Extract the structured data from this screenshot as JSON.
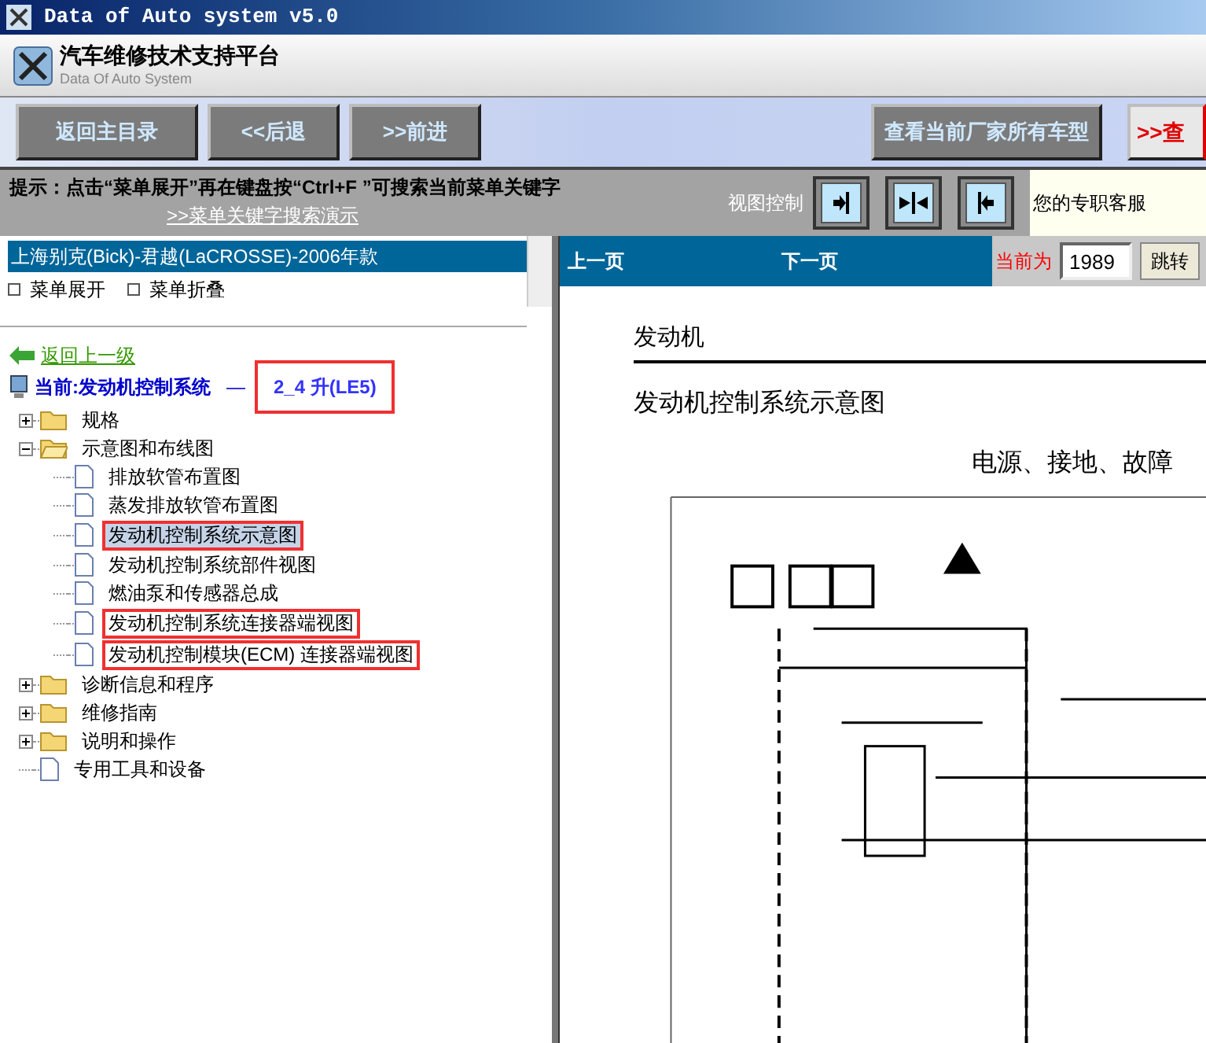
{
  "window": {
    "title": "Data of Auto system v5.0"
  },
  "header": {
    "title": "汽车维修技术支持平台",
    "subtitle": "Data Of Auto System"
  },
  "toolbar": {
    "left_buttons": [
      "返回主目录",
      "<<后退",
      ">>前进"
    ],
    "right_button": "查看当前厂家所有车型",
    "cut_button": ">>查"
  },
  "hint": {
    "text": "提示：点击“菜单展开”再在键盘按“Ctrl+F ”可搜索当前菜单关键字",
    "link": ">>菜单关键字搜索演示",
    "view_label": "视图控制",
    "view_buttons": [
      {
        "kind": "right"
      },
      {
        "kind": "center"
      },
      {
        "kind": "left"
      }
    ],
    "service": "您的专职客服"
  },
  "sidebar": {
    "vehicle": "上海别克(Bick)-君越(LaCROSSE)-2006年款",
    "expand": "菜单展开",
    "collapse": "菜单折叠",
    "back": "返回上一级",
    "current": "当前:发动机控制系统",
    "separator": "—",
    "engine": "2_4 升(LE5)",
    "engine_highlighted": true,
    "tree": [
      {
        "label": "规格",
        "kind": "folder",
        "expanded": false
      },
      {
        "label": "示意图和布线图",
        "kind": "folder",
        "expanded": true,
        "children": [
          {
            "label": "排放软管布置图",
            "kind": "page",
            "selected": false,
            "highlighted": false
          },
          {
            "label": "蒸发排放软管布置图",
            "kind": "page",
            "selected": false,
            "highlighted": false
          },
          {
            "label": "发动机控制系统示意图",
            "kind": "page",
            "selected": true,
            "highlighted": true
          },
          {
            "label": "发动机控制系统部件视图",
            "kind": "page",
            "selected": false,
            "highlighted": false
          },
          {
            "label": "燃油泵和传感器总成",
            "kind": "page",
            "selected": false,
            "highlighted": false
          },
          {
            "label": "发动机控制系统连接器端视图",
            "kind": "page",
            "selected": false,
            "highlighted": true
          },
          {
            "label": "发动机控制模块(ECM) 连接器端视图",
            "kind": "page",
            "selected": false,
            "highlighted": true
          }
        ]
      },
      {
        "label": "诊断信息和程序",
        "kind": "folder",
        "expanded": false
      },
      {
        "label": "维修指南",
        "kind": "folder",
        "expanded": false
      },
      {
        "label": "说明和操作",
        "kind": "folder",
        "expanded": false
      },
      {
        "label": "专用工具和设备",
        "kind": "page"
      }
    ]
  },
  "viewer": {
    "prev": "上一页",
    "next": "下一页",
    "current_label": "当前为",
    "page": "1989",
    "go": "跳转",
    "section": "发动机",
    "title": "发动机控制系统示意图",
    "subtitle": "电源、接地、故障"
  }
}
